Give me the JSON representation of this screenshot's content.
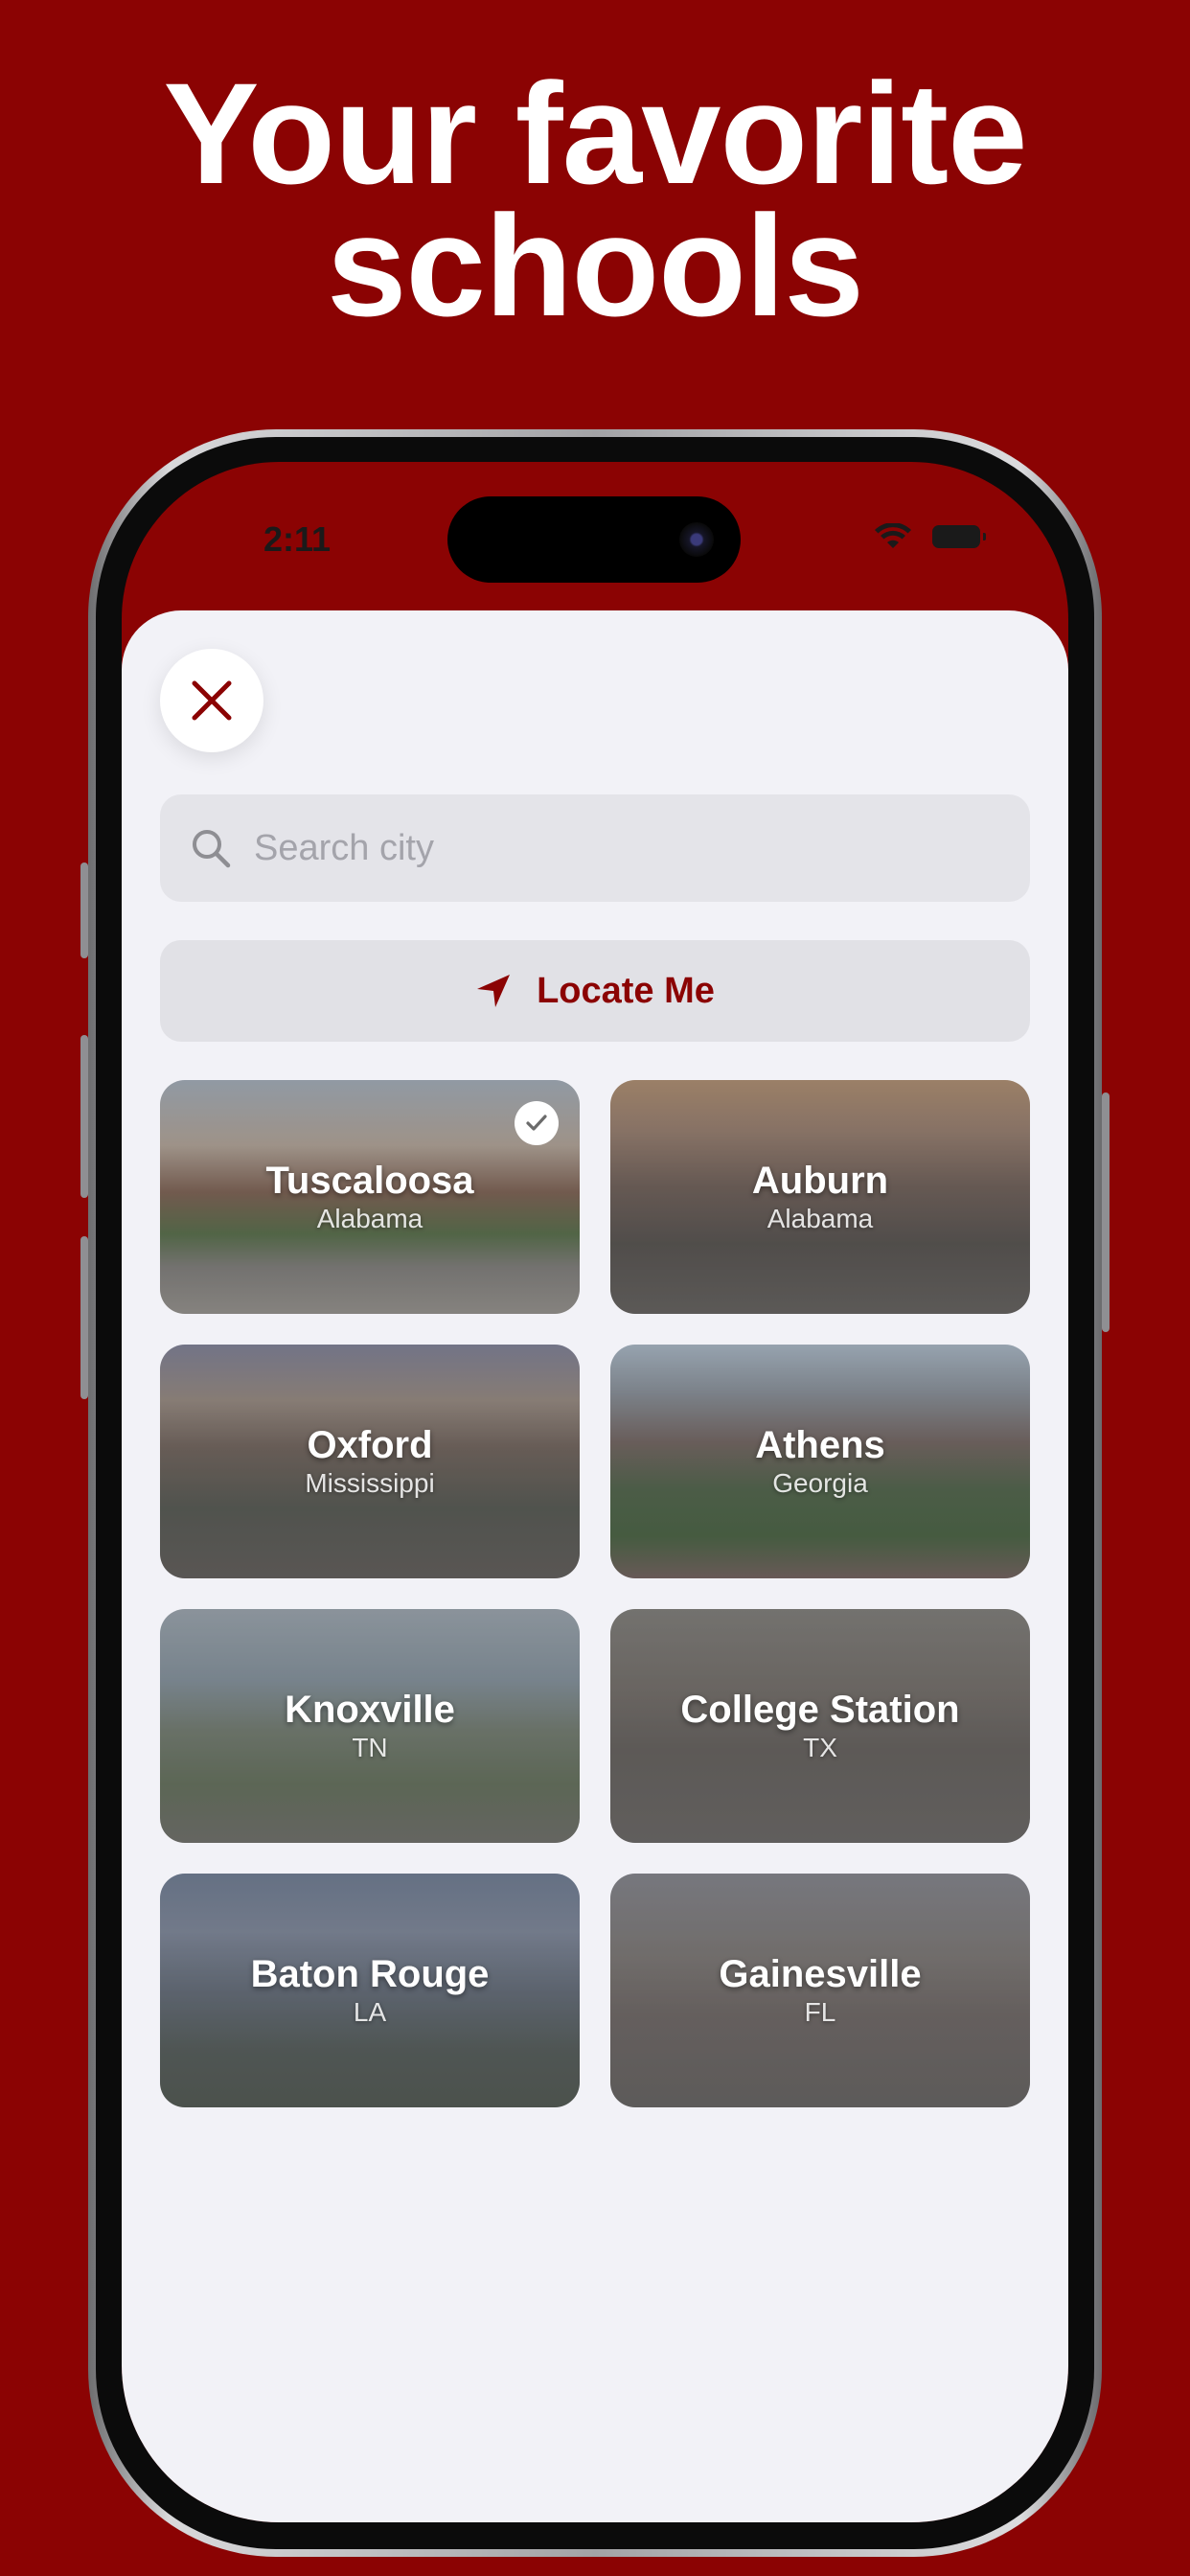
{
  "headline": {
    "line1": "Your favorite",
    "line2": "schools"
  },
  "status_bar": {
    "time": "2:11",
    "icons": [
      "wifi-icon",
      "battery-icon"
    ]
  },
  "sheet": {
    "close_icon": "close-x-icon",
    "search": {
      "placeholder": "Search city",
      "value": "",
      "icon": "search-icon"
    },
    "locate": {
      "label": "Locate Me",
      "icon": "location-arrow-icon"
    },
    "cities": [
      {
        "name": "Tuscaloosa",
        "state": "Alabama",
        "selected": true
      },
      {
        "name": "Auburn",
        "state": "Alabama",
        "selected": false
      },
      {
        "name": "Oxford",
        "state": "Mississippi",
        "selected": false
      },
      {
        "name": "Athens",
        "state": "Georgia",
        "selected": false
      },
      {
        "name": "Knoxville",
        "state": "TN",
        "selected": false
      },
      {
        "name": "College Station",
        "state": "TX",
        "selected": false
      },
      {
        "name": "Baton Rouge",
        "state": "LA",
        "selected": false
      },
      {
        "name": "Gainesville",
        "state": "FL",
        "selected": false
      }
    ]
  },
  "colors": {
    "brand": "#8b0303",
    "sheet_bg": "#f2f2f7",
    "field_bg": "#e4e4e9",
    "white": "#ffffff"
  }
}
